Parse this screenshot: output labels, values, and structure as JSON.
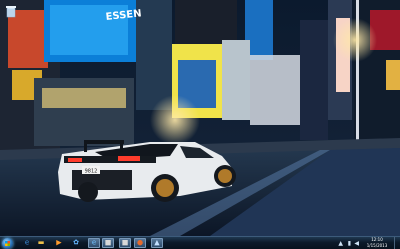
{
  "desktop": {
    "wallpaper": "night-city-street-with-white-sports-car",
    "icon": "recycle-bin-icon",
    "signs": {
      "billboard_top": "ESSEN"
    },
    "license_plate": "9812"
  },
  "taskbar": {
    "start": "windows-start-orb",
    "pinned": [
      {
        "name": "internet-explorer-icon",
        "glyph": "e",
        "color": "#3c8fe0",
        "active": false
      },
      {
        "name": "folder-icon",
        "glyph": "▬",
        "color": "#f0c14a",
        "active": false
      },
      {
        "name": "media-player-icon",
        "glyph": "▶",
        "color": "#ff9b2c",
        "active": false
      },
      {
        "name": "messenger-icon",
        "glyph": "✿",
        "color": "#65b7ff",
        "active": false
      },
      {
        "name": "ie-window-icon",
        "glyph": "e",
        "color": "#6fc0ff",
        "active": true
      },
      {
        "name": "app-window-icon",
        "glyph": "■",
        "color": "#d8d8d8",
        "active": true
      },
      {
        "name": "app-window-icon-2",
        "glyph": "■",
        "color": "#d8d8d8",
        "active": true
      },
      {
        "name": "firefox-icon",
        "glyph": "●",
        "color": "#e86a2b",
        "active": true
      },
      {
        "name": "photo-icon",
        "glyph": "▲",
        "color": "#c4e0ff",
        "active": true
      }
    ],
    "clock": {
      "time": "12:10",
      "date": "1/15/2013"
    }
  }
}
